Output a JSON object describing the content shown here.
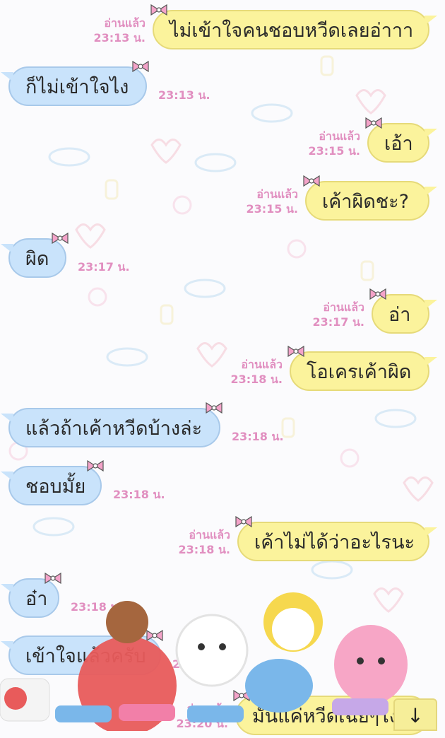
{
  "read_label": "อ่านแล้ว",
  "messages": [
    {
      "dir": "out",
      "text": "ไม่เข้าใจคนชอบหวีดเลยอ่าาา",
      "time": "23:13 น."
    },
    {
      "dir": "in",
      "text": "ก็ไม่เข้าใจไง",
      "time": "23:13 น."
    },
    {
      "dir": "out",
      "text": "เอ้า",
      "time": "23:15 น."
    },
    {
      "dir": "out",
      "text": "เค้าผิดชะ?",
      "time": "23:15 น."
    },
    {
      "dir": "in",
      "text": "ผิด",
      "time": "23:17 น."
    },
    {
      "dir": "out",
      "text": "อ่า",
      "time": "23:17 น."
    },
    {
      "dir": "out",
      "text": "โอเครเค้าผิด",
      "time": "23:18 น."
    },
    {
      "dir": "in",
      "text": "แล้วถ้าเค้าหวีดบ้างล่ะ",
      "time": "23:18 น."
    },
    {
      "dir": "in",
      "text": "ชอบมั้ย",
      "time": "23:18 น."
    },
    {
      "dir": "out",
      "text": "เค้าไม่ได้ว่าอะไรนะ",
      "time": "23:18 น."
    },
    {
      "dir": "in",
      "text": "อ๋า",
      "time": "23:18 น."
    },
    {
      "dir": "in",
      "text": "เข้าใจแล้วครับ",
      "time": "23:20 น."
    },
    {
      "dir": "out",
      "text": "มันแค่หวีดเฉยๆไง",
      "time": "23:20 น."
    }
  ],
  "scroll_button_icon": "arrow-down-icon",
  "scroll_button_glyph": "↓",
  "colors": {
    "outgoing_bubble": "#fbf39c",
    "incoming_bubble": "#c9e3fb",
    "meta_text": "#e18fc0",
    "bow": "#f4a3c9"
  }
}
